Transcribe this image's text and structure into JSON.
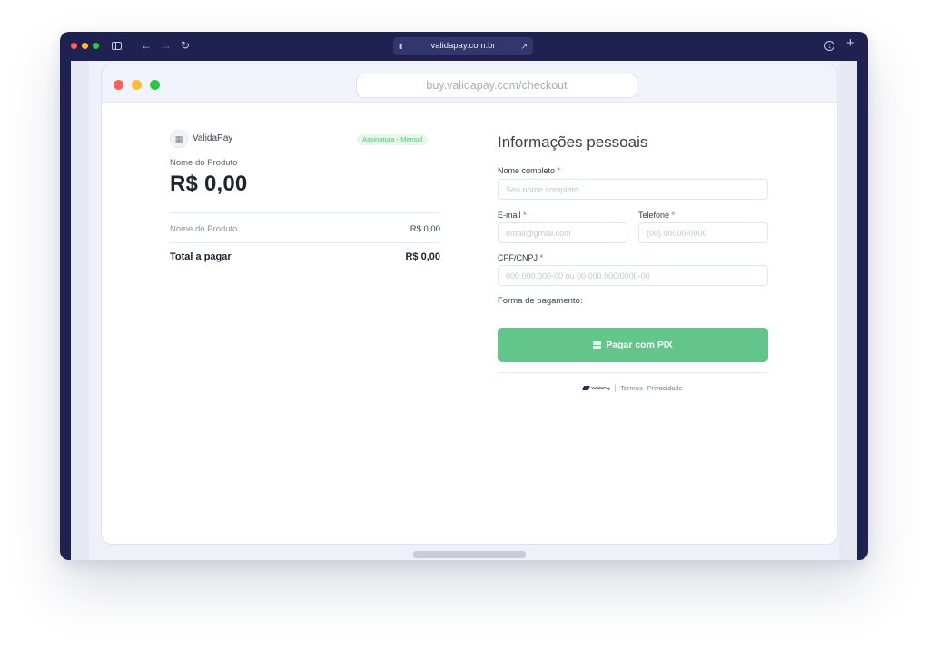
{
  "outer_browser": {
    "address": "validapay.com.br",
    "icons": {
      "sidebar": "sidebar-icon",
      "back": "arrow-left-icon",
      "forward": "arrow-right-icon",
      "reload": "reload-icon",
      "lock": "lock-icon",
      "share": "share-icon",
      "download": "download-icon",
      "new_tab": "plus-icon"
    }
  },
  "inner_window": {
    "url": "buy.validapay.com/checkout"
  },
  "summary": {
    "brand_name": "ValidaPay",
    "brand_icon": "store-icon",
    "plan_badge": "Assinatura - Mensal",
    "product_label": "Nome do Produto",
    "price": "R$ 0,00",
    "line_item": {
      "label": "Nome do Produto",
      "value": "R$ 0,00"
    },
    "total": {
      "label": "Total a pagar",
      "value": "R$ 0,00"
    }
  },
  "form": {
    "title": "Informações pessoais",
    "full_name": {
      "label": "Nome completo",
      "required_mark": "*",
      "placeholder": "Seu nome completo"
    },
    "email": {
      "label": "E-mail",
      "required_mark": "*",
      "placeholder": "email@gmail.com"
    },
    "phone": {
      "label": "Telefone",
      "required_mark": "*",
      "placeholder": "(00) 00000-0000"
    },
    "document": {
      "label": "CPF/CNPJ",
      "required_mark": "*",
      "placeholder": "000.000.000-00 ou 00.000.000/0000-00"
    },
    "payment_label": "Forma de pagamento:",
    "pay_button": "Pagar com PIX",
    "pay_icon": "qr-code-icon"
  },
  "footer": {
    "logo_text": "ValidaPay",
    "terms": "Termos",
    "privacy": "Privacidade"
  },
  "colors": {
    "window_frame": "#1f2150",
    "accent_green": "#63c58a",
    "badge_green": "#5cc07a",
    "required_red": "#e5484d"
  }
}
